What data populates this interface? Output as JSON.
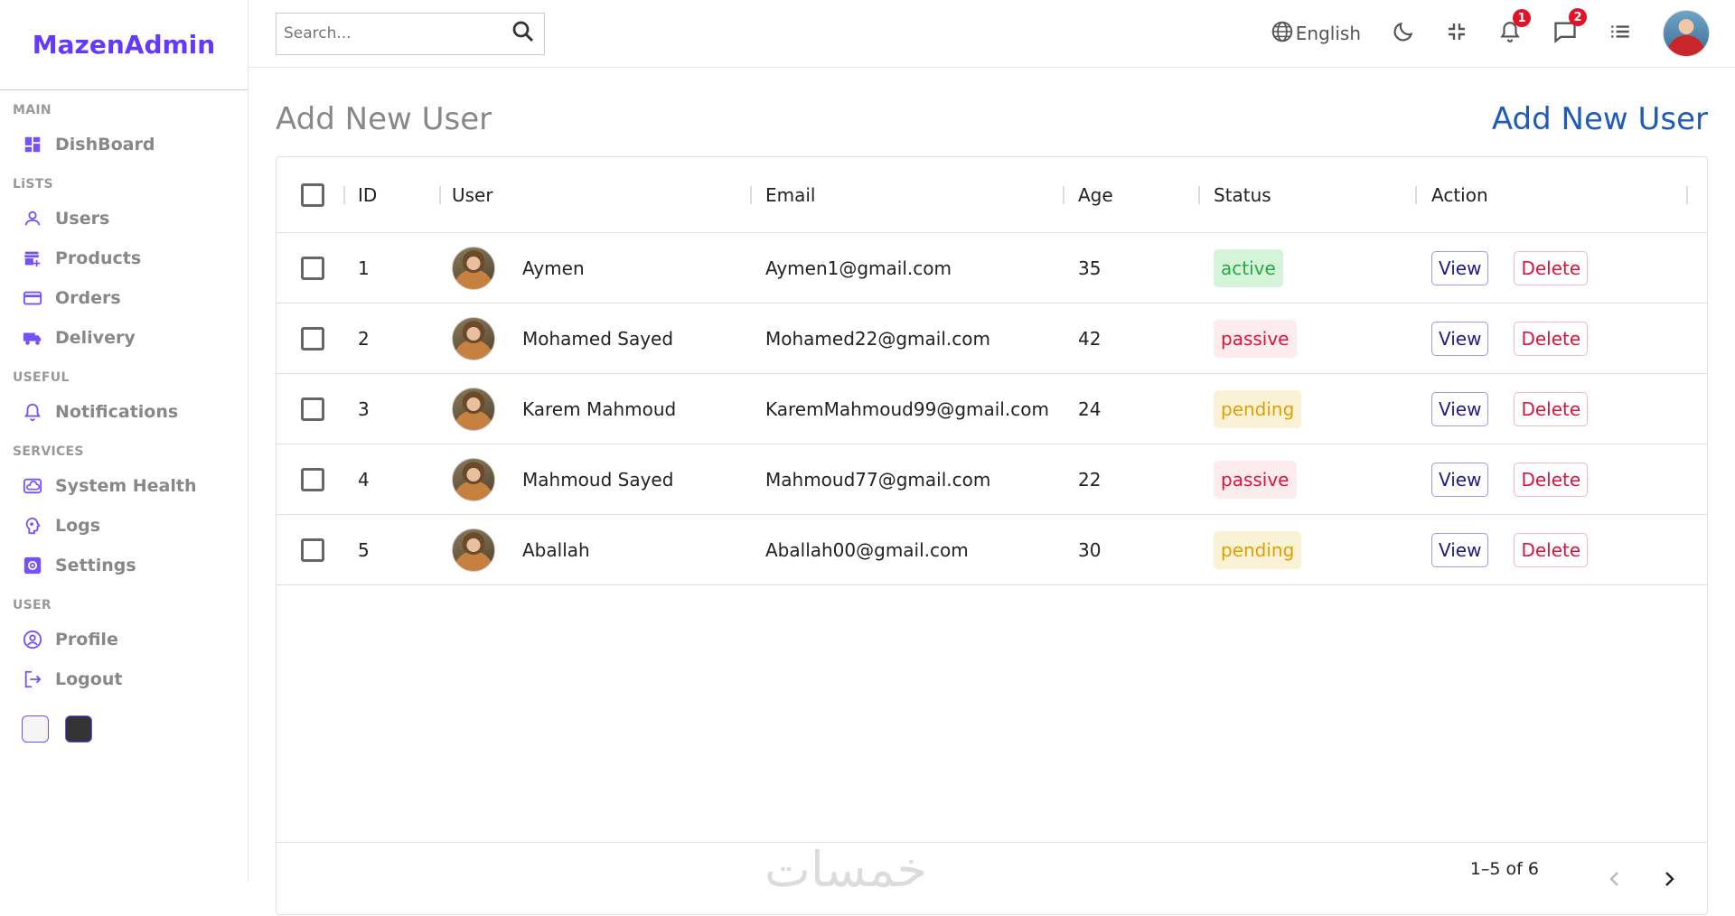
{
  "sidebar": {
    "logo": "MazenAdmin",
    "sections": [
      {
        "title": "MAIN",
        "items": [
          {
            "label": "DishBoard",
            "icon": "dashboard-icon"
          }
        ]
      },
      {
        "title": "LiSTS",
        "items": [
          {
            "label": "Users",
            "icon": "user-icon"
          },
          {
            "label": "Products",
            "icon": "store-icon"
          },
          {
            "label": "Orders",
            "icon": "credit-card-icon"
          },
          {
            "label": "Delivery",
            "icon": "truck-icon"
          }
        ]
      },
      {
        "title": "USEFUL",
        "items": [
          {
            "label": "Notifications",
            "icon": "bell-icon"
          }
        ]
      },
      {
        "title": "SERVICES",
        "items": [
          {
            "label": "System Health",
            "icon": "cloud-icon"
          },
          {
            "label": "Logs",
            "icon": "brain-icon"
          },
          {
            "label": "Settings",
            "icon": "settings-icon"
          }
        ]
      },
      {
        "title": "USER",
        "items": [
          {
            "label": "Profile",
            "icon": "account-circle-icon"
          },
          {
            "label": "Logout",
            "icon": "logout-icon"
          }
        ]
      }
    ],
    "accent": "#7451f8"
  },
  "navbar": {
    "search_placeholder": "Search...",
    "language": "English",
    "notifications_count": "1",
    "messages_count": "2"
  },
  "page": {
    "title": "Add New User",
    "add_link": "Add New User"
  },
  "table": {
    "headers": {
      "id": "ID",
      "user": "User",
      "email": "Email",
      "age": "Age",
      "status": "Status",
      "action": "Action"
    },
    "view_label": "View",
    "delete_label": "Delete",
    "rows": [
      {
        "id": "1",
        "user": "Aymen",
        "email": "Aymen1@gmail.com",
        "age": "35",
        "status": "active"
      },
      {
        "id": "2",
        "user": "Mohamed Sayed",
        "email": "Mohamed22@gmail.com",
        "age": "42",
        "status": "passive"
      },
      {
        "id": "3",
        "user": "Karem Mahmoud",
        "email": "KaremMahmoud99@gmail.com",
        "age": "24",
        "status": "pending"
      },
      {
        "id": "4",
        "user": "Mahmoud Sayed",
        "email": "Mahmoud77@gmail.com",
        "age": "22",
        "status": "passive"
      },
      {
        "id": "5",
        "user": "Aballah",
        "email": "Aballah00@gmail.com",
        "age": "30",
        "status": "pending"
      }
    ],
    "pagination": "1–5 of 6"
  },
  "watermark": "خمسات"
}
